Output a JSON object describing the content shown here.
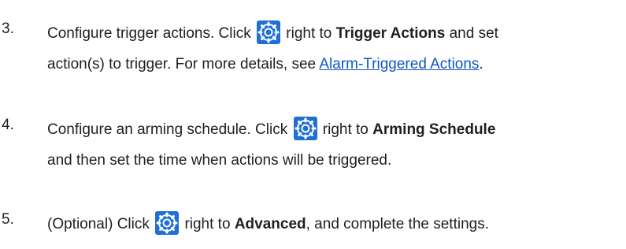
{
  "colors": {
    "text": "#1f1f1f",
    "link": "#1155cc",
    "gear_bg": "#1f6fd6",
    "gear_fg": "#ffffff"
  },
  "icons": {
    "settings": "gear-icon"
  },
  "steps": [
    {
      "number": "3.",
      "line1_a": "Configure trigger actions. Click",
      "line1_b": "right to",
      "bold": "Trigger Actions",
      "line1_c": "and set",
      "line2_a": "action(s) to trigger. For more details, see",
      "link": "Alarm-Triggered Actions",
      "line2_b": "."
    },
    {
      "number": "4.",
      "line1_a": "Configure an arming schedule. Click",
      "line1_b": "right to",
      "bold": "Arming Schedule",
      "line2_a": "and then set the time when actions will be triggered."
    },
    {
      "number": "5.",
      "line1_a": "(Optional) Click",
      "line1_b": "right to",
      "bold": "Advanced",
      "line1_c": ", and complete the settings."
    }
  ]
}
